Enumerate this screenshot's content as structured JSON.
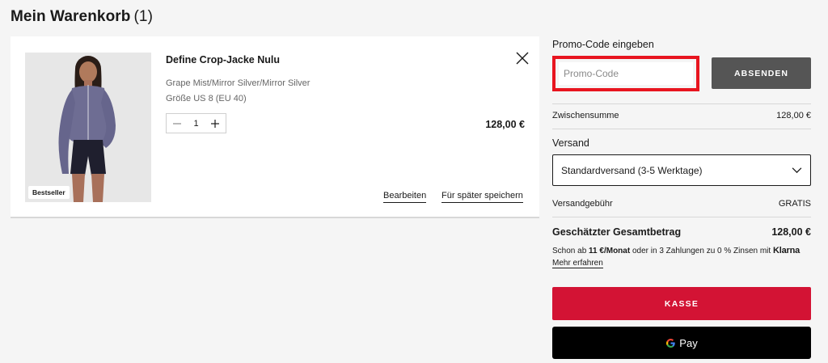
{
  "page": {
    "title": "Mein Warenkorb",
    "count": "(1)"
  },
  "cart": {
    "items": [
      {
        "name": "Define Crop-Jacke Nulu",
        "color": "Grape Mist/Mirror Silver/Mirror Silver",
        "size": "Größe US 8 (EU 40)",
        "quantity": "1",
        "price": "128,00 €",
        "badge": "Bestseller",
        "edit_label": "Bearbeiten",
        "save_later_label": "Für später speichern"
      }
    ]
  },
  "summary": {
    "promo_label": "Promo-Code eingeben",
    "promo_placeholder": "Promo-Code",
    "submit_label": "ABSENDEN",
    "subtotal_label": "Zwischensumme",
    "subtotal_value": "128,00 €",
    "shipping_label": "Versand",
    "shipping_option": "Standardversand (3-5 Werktage)",
    "shipping_fee_label": "Versandgebühr",
    "shipping_fee_value": "GRATIS",
    "total_label": "Geschätzter Gesamtbetrag",
    "total_value": "128,00 €",
    "klarna_prefix": "Schon ab",
    "klarna_amount": "11 €/Monat",
    "klarna_suffix": "oder in 3 Zahlungen zu 0 % Zinsen mit",
    "klarna_brand": "Klarna",
    "learn_more": "Mehr erfahren",
    "checkout_label": "KASSE",
    "gpay_label": "Pay"
  },
  "colors": {
    "checkout": "#d31334",
    "highlight": "#e8151f",
    "submit": "#555555"
  }
}
